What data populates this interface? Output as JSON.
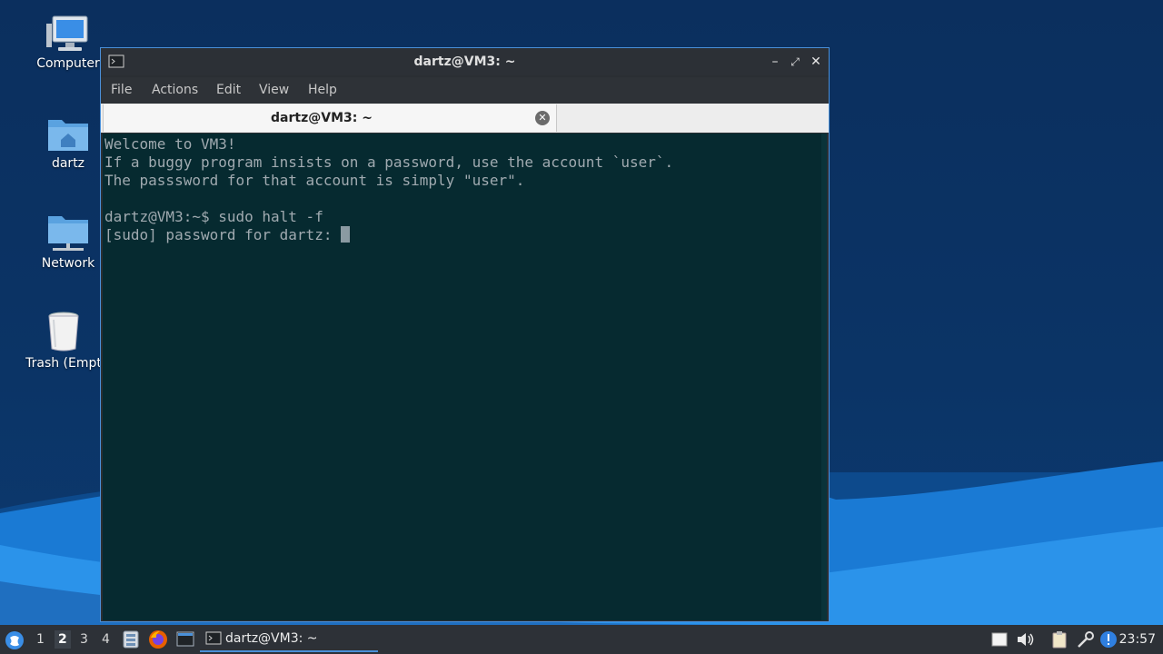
{
  "desktop": {
    "icons": [
      {
        "label": "Computer",
        "icon": "computer-icon"
      },
      {
        "label": "dartz",
        "icon": "home-folder-icon"
      },
      {
        "label": "Network",
        "icon": "network-folder-icon"
      },
      {
        "label": "Trash (Empt",
        "icon": "trash-icon"
      }
    ]
  },
  "window": {
    "title": "dartz@VM3: ~",
    "menu": [
      "File",
      "Actions",
      "Edit",
      "View",
      "Help"
    ],
    "tab_label": "dartz@VM3: ~",
    "controls": {
      "minimize": "–",
      "maximize": "⤢",
      "close": "✕"
    }
  },
  "terminal": {
    "lines": [
      "Welcome to VM3!",
      "If a buggy program insists on a password, use the account `user`.",
      "The passsword for that account is simply \"user\".",
      "",
      "dartz@VM3:~$ sudo halt -f",
      "[sudo] password for dartz: "
    ],
    "colors": {
      "background": "#062a30",
      "foreground": "#a0aab0"
    }
  },
  "taskbar": {
    "workspaces": [
      "1",
      "2",
      "3",
      "4"
    ],
    "active_workspace": "2",
    "task_label": "dartz@VM3: ~",
    "clock": "23:57",
    "launchers": [
      "file-manager-icon",
      "firefox-icon",
      "terminal-icon"
    ],
    "tray": [
      "notes-icon",
      "volume-icon",
      "clipboard-icon",
      "network-icon",
      "update-alert-icon"
    ]
  },
  "colors": {
    "accent": "#4a90d9",
    "taskbar": "#2d3137",
    "desktop": "#0b2f5e"
  }
}
